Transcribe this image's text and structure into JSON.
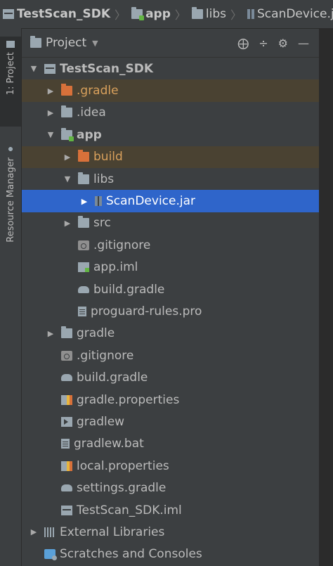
{
  "breadcrumb": [
    {
      "label": "TestScan_SDK",
      "icon": "project-icon",
      "bold": true
    },
    {
      "label": "app",
      "icon": "module-folder-icon",
      "bold": true
    },
    {
      "label": "libs",
      "icon": "folder-icon",
      "bold": false
    },
    {
      "label": "ScanDevice.jar",
      "icon": "jar-icon",
      "bold": false
    }
  ],
  "left_strip": {
    "tabs": [
      {
        "label": "1: Project",
        "icon": "folder-icon",
        "active": true
      },
      {
        "label": "Resource Manager",
        "icon": "resource-manager-icon",
        "active": false
      }
    ]
  },
  "panel": {
    "view_label": "Project",
    "tools": [
      "target-icon",
      "collapse-icon",
      "gear-icon",
      "minimize-icon"
    ]
  },
  "tree": [
    {
      "label": "TestScan_SDK",
      "level": 0,
      "arrow": "expanded",
      "icon": "project-icon",
      "bold": true,
      "excluded": false,
      "selected": false
    },
    {
      "label": ".gradle",
      "level": 1,
      "arrow": "collapsed",
      "icon": "excluded-folder-icon",
      "bold": false,
      "excluded": true,
      "selected": false
    },
    {
      "label": ".idea",
      "level": 1,
      "arrow": "collapsed",
      "icon": "folder-icon",
      "bold": false,
      "excluded": false,
      "selected": false
    },
    {
      "label": "app",
      "level": 1,
      "arrow": "expanded",
      "icon": "module-folder-icon",
      "bold": true,
      "excluded": false,
      "selected": false
    },
    {
      "label": "build",
      "level": 2,
      "arrow": "collapsed",
      "icon": "excluded-folder-icon",
      "bold": false,
      "excluded": true,
      "selected": false
    },
    {
      "label": "libs",
      "level": 2,
      "arrow": "expanded",
      "icon": "folder-icon",
      "bold": false,
      "excluded": false,
      "selected": false
    },
    {
      "label": "ScanDevice.jar",
      "level": 3,
      "arrow": "collapsed",
      "icon": "jar-icon",
      "bold": false,
      "excluded": false,
      "selected": true
    },
    {
      "label": "src",
      "level": 2,
      "arrow": "collapsed",
      "icon": "folder-icon",
      "bold": false,
      "excluded": false,
      "selected": false
    },
    {
      "label": ".gitignore",
      "level": 2,
      "arrow": "none",
      "icon": "gitignore-icon",
      "bold": false,
      "excluded": false,
      "selected": false
    },
    {
      "label": "app.iml",
      "level": 2,
      "arrow": "none",
      "icon": "iml-icon",
      "bold": false,
      "excluded": false,
      "selected": false
    },
    {
      "label": "build.gradle",
      "level": 2,
      "arrow": "none",
      "icon": "gradle-icon",
      "bold": false,
      "excluded": false,
      "selected": false
    },
    {
      "label": "proguard-rules.pro",
      "level": 2,
      "arrow": "none",
      "icon": "text-file-icon",
      "bold": false,
      "excluded": false,
      "selected": false
    },
    {
      "label": "gradle",
      "level": 1,
      "arrow": "collapsed",
      "icon": "folder-icon",
      "bold": false,
      "excluded": false,
      "selected": false
    },
    {
      "label": ".gitignore",
      "level": 1,
      "arrow": "none",
      "icon": "gitignore-icon",
      "bold": false,
      "excluded": false,
      "selected": false
    },
    {
      "label": "build.gradle",
      "level": 1,
      "arrow": "none",
      "icon": "gradle-icon",
      "bold": false,
      "excluded": false,
      "selected": false
    },
    {
      "label": "gradle.properties",
      "level": 1,
      "arrow": "none",
      "icon": "properties-icon",
      "bold": false,
      "excluded": false,
      "selected": false
    },
    {
      "label": "gradlew",
      "level": 1,
      "arrow": "none",
      "icon": "executable-icon",
      "bold": false,
      "excluded": false,
      "selected": false
    },
    {
      "label": "gradlew.bat",
      "level": 1,
      "arrow": "none",
      "icon": "text-file-icon",
      "bold": false,
      "excluded": false,
      "selected": false
    },
    {
      "label": "local.properties",
      "level": 1,
      "arrow": "none",
      "icon": "properties-icon",
      "bold": false,
      "excluded": false,
      "selected": false
    },
    {
      "label": "settings.gradle",
      "level": 1,
      "arrow": "none",
      "icon": "gradle-icon",
      "bold": false,
      "excluded": false,
      "selected": false
    },
    {
      "label": "TestScan_SDK.iml",
      "level": 1,
      "arrow": "none",
      "icon": "project-icon",
      "bold": false,
      "excluded": false,
      "selected": false
    },
    {
      "label": "External Libraries",
      "level": 0,
      "arrow": "collapsed",
      "icon": "libraries-icon",
      "bold": false,
      "excluded": false,
      "selected": false
    },
    {
      "label": "Scratches and Consoles",
      "level": 0,
      "arrow": "none",
      "icon": "scratches-icon",
      "bold": false,
      "excluded": false,
      "selected": false
    }
  ],
  "colors": {
    "background": "#3c3f41",
    "selection": "#2f65ca",
    "excluded_row": "#4a4232",
    "excluded_text": "#d8a05c",
    "module_marker": "#62b543"
  }
}
